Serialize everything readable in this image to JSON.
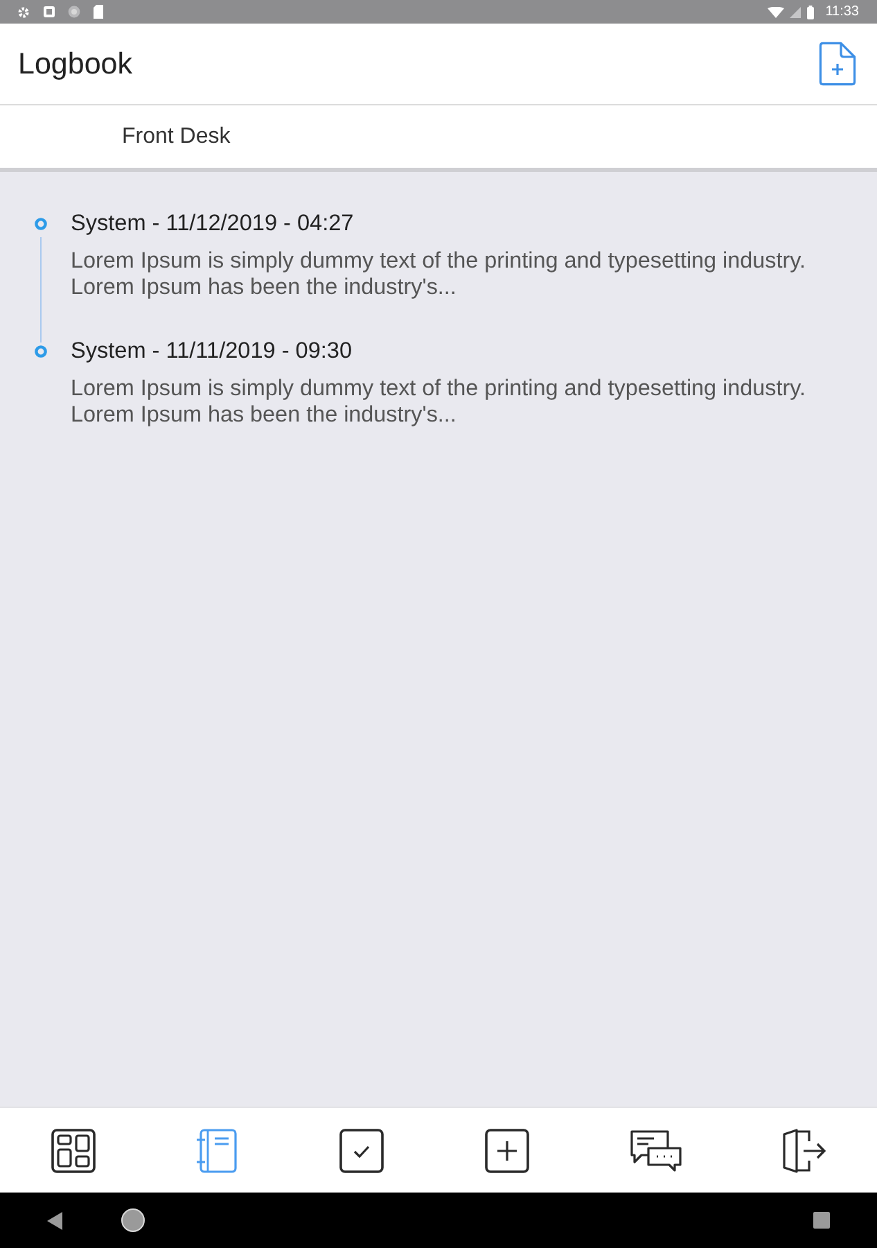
{
  "status_bar": {
    "time": "11:33"
  },
  "app_bar": {
    "title": "Logbook"
  },
  "location": {
    "label": "Front Desk"
  },
  "entries": [
    {
      "title": "System - 11/12/2019 - 04:27",
      "text": "Lorem Ipsum is simply dummy text of the printing and typesetting industry. Lorem Ipsum has been the industry's..."
    },
    {
      "title": "System - 11/11/2019 - 09:30",
      "text": "Lorem Ipsum is simply dummy text of the printing and typesetting industry. Lorem Ipsum has been the industry's..."
    }
  ],
  "bottom_nav": [
    {
      "kind": "dashboard",
      "selected": false
    },
    {
      "kind": "logbook",
      "selected": true
    },
    {
      "kind": "tasks",
      "selected": false
    },
    {
      "kind": "add",
      "selected": false
    },
    {
      "kind": "messages",
      "selected": false
    },
    {
      "kind": "logout",
      "selected": false
    }
  ]
}
